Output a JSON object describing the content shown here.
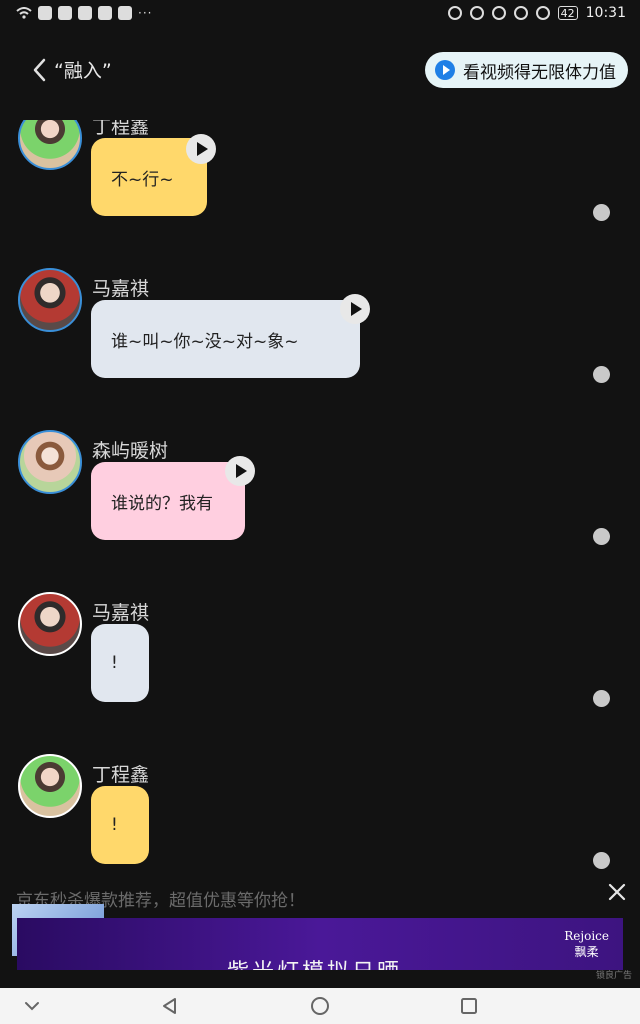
{
  "status_bar": {
    "time": "10:31",
    "battery": "42",
    "left_overflow": "···"
  },
  "header": {
    "title": "“融入”",
    "promo_label": "看视频得无限体力值"
  },
  "messages": [
    {
      "sender": "丁程鑫",
      "text": "不~行~",
      "bubble_color": "#ffd86b",
      "has_voice": true
    },
    {
      "sender": "马嘉祺",
      "text": "谁~叫~你~没~对~象~",
      "bubble_color": "#e1e7ef",
      "has_voice": true
    },
    {
      "sender": "森屿暖树",
      "text": "谁说的？我有",
      "bubble_color": "#ffcfe0",
      "has_voice": true
    },
    {
      "sender": "马嘉祺",
      "text": "!",
      "bubble_color": "#e1e7ef",
      "has_voice": false
    },
    {
      "sender": "丁程鑫",
      "text": "!",
      "bubble_color": "#ffd86b",
      "has_voice": false
    }
  ],
  "ad": {
    "headline": "京东秒杀爆款推荐，超值优惠等你抢！",
    "banner_text": "紫光灯模拟日晒",
    "brand_line1": "Rejoice",
    "brand_line2": "飘柔",
    "label": "锁良广告"
  }
}
